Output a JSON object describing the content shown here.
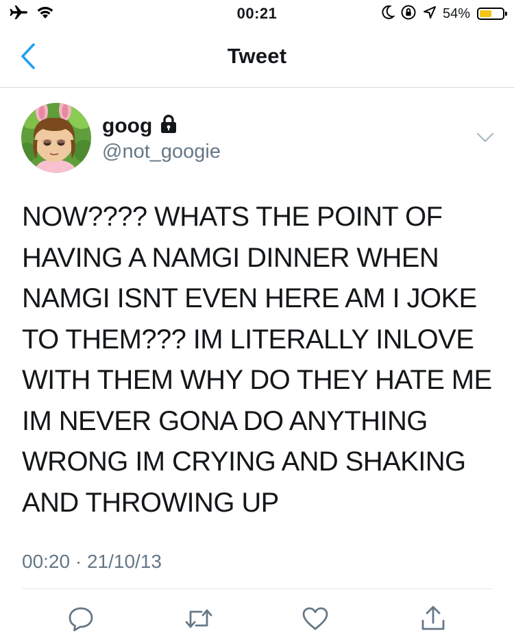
{
  "status_bar": {
    "time": "00:21",
    "battery_percent": "54%",
    "battery_level": 0.54,
    "battery_color": "#f5c518",
    "icons_left": [
      "airplane-icon",
      "wifi-icon"
    ],
    "icons_right": [
      "moon-icon",
      "orientation-lock-icon",
      "location-icon"
    ]
  },
  "nav": {
    "title": "Tweet",
    "back_icon": "chevron-left-icon",
    "accent_color": "#1da1f2"
  },
  "tweet": {
    "display_name": "goog",
    "protected_icon": "lock-icon",
    "username": "@not_googie",
    "text": "NOW???? WHATS THE POINT OF\nHAVING A NAMGI DINNER WHEN\nNAMGI ISNT EVEN HERE AM I JOKE\nTO THEM??? IM LITERALLY INLOVE\nWITH THEM WHY DO THEY HATE ME\nIM NEVER GONA DO ANYTHING\nWRONG IM CRYING AND SHAKING\nAND THROWING UP",
    "timestamp": "00:20 · 21/10/13"
  },
  "actions": [
    {
      "name": "reply",
      "icon": "reply-icon"
    },
    {
      "name": "retweet",
      "icon": "retweet-icon"
    },
    {
      "name": "like",
      "icon": "heart-icon"
    },
    {
      "name": "share",
      "icon": "share-icon"
    }
  ],
  "colors": {
    "text_primary": "#14171a",
    "text_secondary": "#657786",
    "icon_gray": "#657786"
  }
}
